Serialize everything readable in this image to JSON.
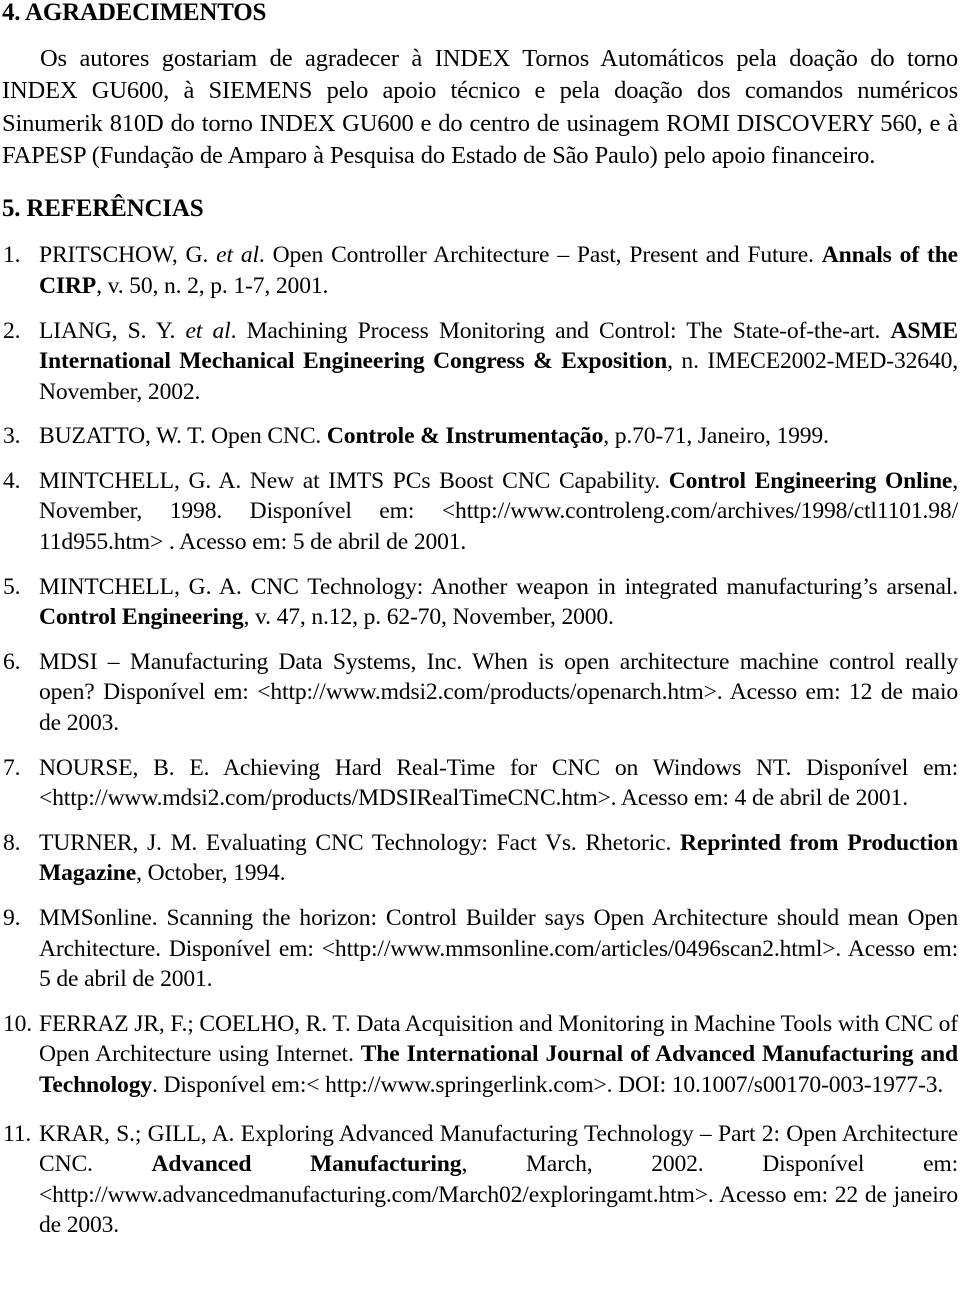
{
  "document": {
    "language": "pt-BR",
    "text_color": "#000000",
    "background_color": "#ffffff"
  },
  "sections": {
    "acknowledgments": {
      "heading": "4. AGRADECIMENTOS",
      "paragraph": "Os autores gostariam de agradecer à INDEX  Tornos Automáticos pela doação do torno INDEX GU600, à SIEMENS pelo apoio técnico e pela doação dos comandos numéricos Sinumerik 810D do torno INDEX GU600 e do centro de usinagem ROMI DISCOVERY 560, e à FAPESP (Fundação de Amparo à Pesquisa do Estado de São Paulo) pelo apoio financeiro."
    },
    "references": {
      "heading": "5. REFERÊNCIAS",
      "items": [
        {
          "number": "1.",
          "parts": [
            {
              "text": "PRITSCHOW, G. ",
              "style": "normal"
            },
            {
              "text": "et al",
              "style": "italic"
            },
            {
              "text": ".  Open Controller Architecture – Past, Present and Future.  ",
              "style": "normal"
            },
            {
              "text": "Annals of the CIRP",
              "style": "bold"
            },
            {
              "text": ", v. 50, n. 2, p. 1-7, 2001.",
              "style": "normal"
            }
          ]
        },
        {
          "number": "2.",
          "parts": [
            {
              "text": "LIANG, S. Y. ",
              "style": "normal"
            },
            {
              "text": "et al",
              "style": "italic"
            },
            {
              "text": ".  Machining Process Monitoring and Control: The State-of-the-art.  ",
              "style": "normal"
            },
            {
              "text": "ASME International Mechanical Engineering Congress & Exposition",
              "style": "bold"
            },
            {
              "text": ", n. IMECE2002-MED-32640, November, 2002.",
              "style": "normal"
            }
          ]
        },
        {
          "number": "3.",
          "parts": [
            {
              "text": "BUZATTO, W. T. Open CNC. ",
              "style": "normal"
            },
            {
              "text": "Controle & Instrumentação",
              "style": "bold"
            },
            {
              "text": ", p.70-71, Janeiro, 1999.",
              "style": "normal"
            }
          ]
        },
        {
          "number": "4.",
          "parts": [
            {
              "text": "MINTCHELL, G. A. New at IMTS PCs Boost CNC Capability. ",
              "style": "normal"
            },
            {
              "text": "Control Engineering Online",
              "style": "bold"
            },
            {
              "text": ", November, 1998. Disponível em: <http://www.controleng.com/archives/1998/ctl1101.98/ 11d955.htm> . Acesso em: 5 de abril de 2001.",
              "style": "normal"
            }
          ]
        },
        {
          "number": "5.",
          "parts": [
            {
              "text": "MINTCHELL, G. A.  CNC Technology: Another weapon in integrated manufacturing’s arsenal. ",
              "style": "normal"
            },
            {
              "text": "Control Engineering",
              "style": "bold"
            },
            {
              "text": ", v. 47, n.12, p. 62-70, November, 2000.",
              "style": "normal"
            }
          ]
        },
        {
          "number": "6.",
          "parts": [
            {
              "text": "MDSI – Manufacturing Data Systems, Inc.  When is open architecture machine control really open? Disponível em: <http://www.mdsi2.com/products/openarch.htm>. Acesso em: 12 de maio de 2003.",
              "style": "normal"
            }
          ]
        },
        {
          "number": "7.",
          "parts": [
            {
              "text": "NOURSE, B. E.   Achieving Hard Real-Time for CNC on Windows NT. Disponível em: <http://www.mdsi2.com/products/MDSIRealTimeCNC.htm>. Acesso em: 4 de abril de 2001.",
              "style": "normal"
            }
          ]
        },
        {
          "number": "8.",
          "parts": [
            {
              "text": "TURNER, J. M. Evaluating CNC Technology: Fact Vs. Rhetoric. ",
              "style": "normal"
            },
            {
              "text": "Reprinted from Production Magazine",
              "style": "bold"
            },
            {
              "text": ", October, 1994.",
              "style": "normal"
            }
          ]
        },
        {
          "number": "9.",
          "parts": [
            {
              "text": "MMSonline.  Scanning the horizon: Control Builder says Open Architecture should mean Open Architecture.  Disponível em: <http://www.mmsonline.com/articles/0496scan2.html>. Acesso em: 5 de abril de 2001.",
              "style": "normal"
            }
          ]
        },
        {
          "number": "10.",
          "parts": [
            {
              "text": "FERRAZ JR, F.; COELHO, R. T.  Data Acquisition and Monitoring in Machine Tools with CNC of Open Architecture using Internet.  ",
              "style": "normal"
            },
            {
              "text": "The International Journal of Advanced Manufacturing and Technology",
              "style": "bold"
            },
            {
              "text": ".  Disponível em:< http://www.springerlink.com>.  DOI: 10.1007/s00170-003-1977-3.",
              "style": "normal"
            }
          ]
        },
        {
          "number": "11.",
          "parts": [
            {
              "text": "KRAR, S.; GILL, A.  Exploring Advanced Manufacturing Technology – Part 2: Open Architecture CNC. ",
              "style": "normal"
            },
            {
              "text": "Advanced Manufacturing",
              "style": "bold"
            },
            {
              "text": ", March, 2002. Disponível em: <http://www.advancedmanufacturing.com/March02/exploringamt.htm>.  Acesso em: 22 de janeiro de 2003.",
              "style": "normal"
            }
          ]
        }
      ]
    }
  }
}
